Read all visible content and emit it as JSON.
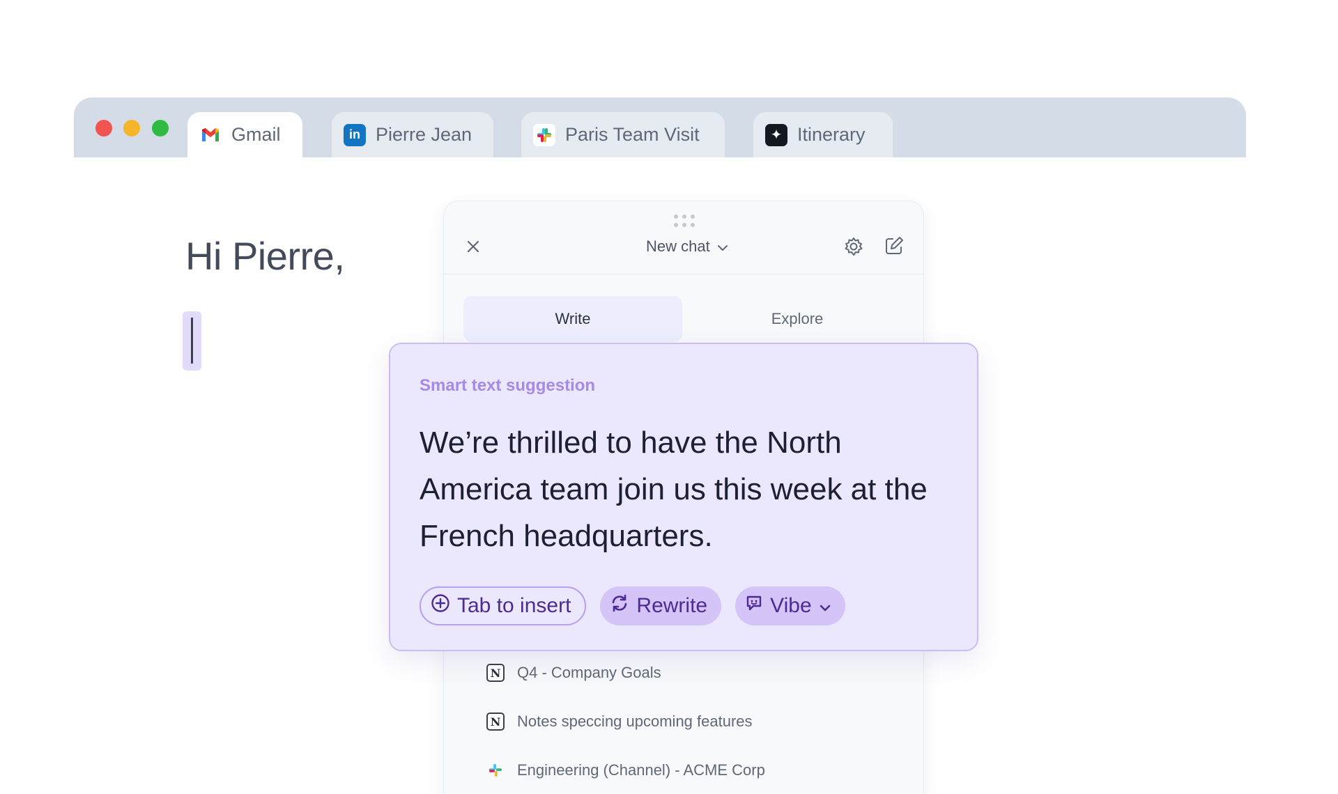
{
  "browser": {
    "tabs": [
      {
        "label": "Gmail",
        "icon": "gmail-icon",
        "active": true
      },
      {
        "label": "Pierre Jean",
        "icon": "linkedin-icon",
        "active": false
      },
      {
        "label": "Paris Team Visit",
        "icon": "slack-icon",
        "active": false
      },
      {
        "label": "Itinerary",
        "icon": "sparkle-icon",
        "active": false
      }
    ],
    "linkedin_glyph": "in",
    "sparkle_glyph": "✦"
  },
  "email": {
    "greeting": "Hi Pierre,"
  },
  "panel": {
    "title": "New chat",
    "modes": [
      {
        "label": "Write",
        "selected": true
      },
      {
        "label": "Explore",
        "selected": false
      }
    ],
    "sources": [
      {
        "label": "Q4 - Company Goals",
        "icon": "notion-icon"
      },
      {
        "label": "Notes speccing upcoming features",
        "icon": "notion-icon"
      },
      {
        "label": "Engineering (Channel) - ACME Corp",
        "icon": "slack-icon"
      }
    ],
    "notion_glyph": "N"
  },
  "suggestion": {
    "label": "Smart text suggestion",
    "text": "We’re thrilled to have the North America team join us this week at the French headquarters.",
    "actions": {
      "insert": "Tab to insert",
      "rewrite": "Rewrite",
      "vibe": "Vibe"
    }
  },
  "colors": {
    "accent": "#4d2a94",
    "suggestion_bg": "#ebe7fc",
    "suggestion_label": "#a58ae8"
  }
}
